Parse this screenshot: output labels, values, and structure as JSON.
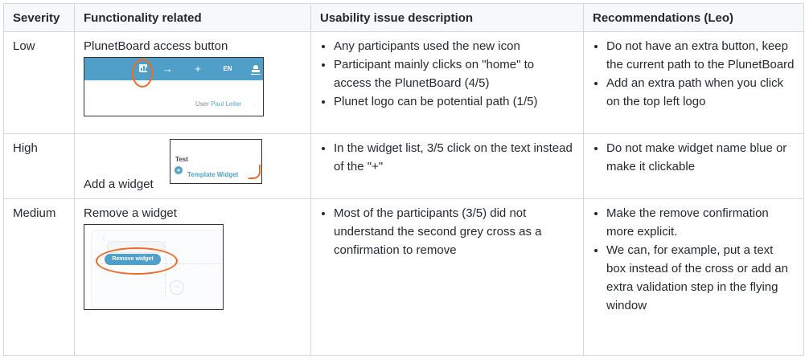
{
  "headers": {
    "severity": "Severity",
    "functionality": "Functionality related",
    "description": "Usability issue description",
    "recommendations": "Recommendations (Leo)"
  },
  "rows": [
    {
      "severity": "Low",
      "functionality": "PlunetBoard access button",
      "description": [
        "Any participants used the new icon",
        "Participant mainly clicks on \"home\" to access the PlunetBoard (4/5)",
        "Plunet logo can be potential path (1/5)"
      ],
      "recommendations": [
        "Do not have an extra button, keep the current path to the PlunetBoard",
        "Add an extra path when you click on the top left logo"
      ],
      "thumbnail": {
        "toolbar_color": "#4f9fc9",
        "icons": [
          "dashboard-icon",
          "arrow-right-icon",
          "plus-icon",
          "language-icon",
          "user-icon"
        ],
        "arrow_glyph": "→",
        "plus_glyph": "+",
        "language": "EN",
        "user_prefix": "User",
        "user_name": "Paul Leiter",
        "faint_glyph": "→",
        "highlight_color": "#f06a24"
      }
    },
    {
      "severity": "High",
      "functionality": "Add a widget",
      "description": [
        "In the widget list, 3/5 click on the text instead of the \"+\""
      ],
      "recommendations": [
        "Do not make widget name blue or make it clickable"
      ],
      "thumbnail": {
        "title": "Test",
        "add_glyph": "+",
        "widget_name": "Template Widget"
      }
    },
    {
      "severity": "Medium",
      "functionality": "Remove a widget",
      "description": [
        "Most of the participants (3/5) did not understand the second grey cross as a confirmation to remove"
      ],
      "recommendations": [
        "Make the remove confirmation more explicit.",
        "We can, for example, put a text box instead of the cross or add an extra validation step in the flying window"
      ],
      "thumbnail": {
        "button_label": "Remove widget",
        "drag_glyph": "⋮",
        "cross_glyph": "−"
      }
    }
  ]
}
